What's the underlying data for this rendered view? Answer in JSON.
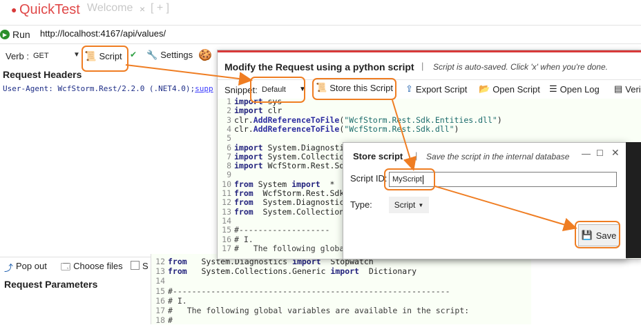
{
  "app": {
    "title": "QuickTest",
    "tab_welcome": "Welcome",
    "tab_close": "×",
    "tab_add": "[ + ]"
  },
  "urlbar": {
    "run_label": "Run",
    "url": "http://localhost:4167/api/values/"
  },
  "toolbar": {
    "verb_label": "Verb :",
    "verb_value": "GET",
    "script_label": "Script",
    "settings_label": "Settings"
  },
  "left": {
    "request_headers_title": "Request Headers",
    "header_key": "User-Agent:",
    "header_value": " WcfStorm.Rest/2.2.0 (.NET4.0);",
    "header_tail": "supp",
    "popout_label": "Pop out",
    "choosefiles_label": "Choose files",
    "small_s": "S",
    "request_params_title": "Request Parameters"
  },
  "modify": {
    "title": "Modify the Request using a python script",
    "separator": "|",
    "subtitle": "Script is auto-saved. Click 'x' when you're done.",
    "snippet_label": "Snippet:",
    "snippet_value": "Default",
    "store_label": "Store this Script",
    "export_label": "Export Script",
    "open_label": "Open Script",
    "openlog_label": "Open Log",
    "veri_label": "Veri"
  },
  "code_lines": [
    {
      "n": "1",
      "parts": [
        [
          "kw",
          "import"
        ],
        [
          "",
          "sys"
        ]
      ]
    },
    {
      "n": "2",
      "parts": [
        [
          "kw",
          "import"
        ],
        [
          "",
          "clr"
        ]
      ]
    },
    {
      "n": "3",
      "parts": [
        [
          "",
          "clr."
        ],
        [
          "fn",
          "AddReferenceToFile"
        ],
        [
          "",
          "("
        ],
        [
          "str",
          "\"WcfStorm.Rest.Sdk.Entities.dll\""
        ],
        [
          "",
          ")"
        ]
      ]
    },
    {
      "n": "4",
      "parts": [
        [
          "",
          "clr."
        ],
        [
          "fn",
          "AddReferenceToFile"
        ],
        [
          "",
          "("
        ],
        [
          "str",
          "\"WcfStorm.Rest.Sdk.dll\""
        ],
        [
          "",
          ")"
        ]
      ]
    },
    {
      "n": "5",
      "parts": []
    },
    {
      "n": "6",
      "parts": [
        [
          "kw",
          "import"
        ],
        [
          "",
          "System.Diagnostics"
        ]
      ]
    },
    {
      "n": "7",
      "parts": [
        [
          "kw",
          "import"
        ],
        [
          "",
          "System.Collections"
        ]
      ]
    },
    {
      "n": "8",
      "parts": [
        [
          "kw",
          "import"
        ],
        [
          "",
          "WcfStorm.Rest.Sdk"
        ]
      ]
    },
    {
      "n": "9",
      "parts": []
    },
    {
      "n": "10",
      "parts": [
        [
          "kw",
          "from"
        ],
        [
          "",
          "System "
        ],
        [
          "kw",
          "import"
        ],
        [
          "",
          " *"
        ]
      ]
    },
    {
      "n": "11",
      "parts": [
        [
          "kw",
          "from"
        ],
        [
          "",
          " WcfStorm.Rest.Sdk "
        ],
        [
          "kw",
          "i"
        ]
      ]
    },
    {
      "n": "12",
      "parts": [
        [
          "kw",
          "from"
        ],
        [
          "",
          " System.Diagnostics"
        ]
      ]
    },
    {
      "n": "13",
      "parts": [
        [
          "kw",
          "from"
        ],
        [
          "",
          " System.Collections"
        ]
      ]
    },
    {
      "n": "14",
      "parts": []
    },
    {
      "n": "15",
      "parts": [
        [
          "cm",
          "#-------------------"
        ]
      ]
    },
    {
      "n": "16",
      "parts": [
        [
          "cm",
          "# I."
        ]
      ]
    },
    {
      "n": "17",
      "parts": [
        [
          "cm",
          "#   The following global"
        ]
      ]
    }
  ],
  "bottom_code_lines": [
    {
      "n": "12",
      "parts": [
        [
          "kw",
          "from"
        ],
        [
          "",
          "  System.Diagnostics "
        ],
        [
          "kw",
          "import"
        ],
        [
          "",
          " Stopwatch"
        ]
      ]
    },
    {
      "n": "13",
      "parts": [
        [
          "kw",
          "from"
        ],
        [
          "",
          "  System.Collections.Generic "
        ],
        [
          "kw",
          "import"
        ],
        [
          "",
          " Dictionary"
        ]
      ]
    },
    {
      "n": "14",
      "parts": []
    },
    {
      "n": "15",
      "parts": [
        [
          "cm",
          "#----------------------------------------------------------"
        ]
      ]
    },
    {
      "n": "16",
      "parts": [
        [
          "cm",
          "# I."
        ]
      ]
    },
    {
      "n": "17",
      "parts": [
        [
          "cm",
          "#   The following global variables are available in the script:"
        ]
      ]
    },
    {
      "n": "18",
      "parts": [
        [
          "cm",
          "#"
        ]
      ]
    }
  ],
  "store": {
    "title": "Store script",
    "separator": "|",
    "subtitle": "Save the script in the internal database",
    "min": "—",
    "max": "☐",
    "close": "✕",
    "scriptid_label": "Script ID:",
    "scriptid_value": "MyScript",
    "type_label": "Type:",
    "type_value": "Script",
    "save_label": "Save"
  },
  "colors": {
    "accent": "#ef7d22",
    "brand_red": "#d83a3a",
    "run_green": "#2b8f2b"
  }
}
